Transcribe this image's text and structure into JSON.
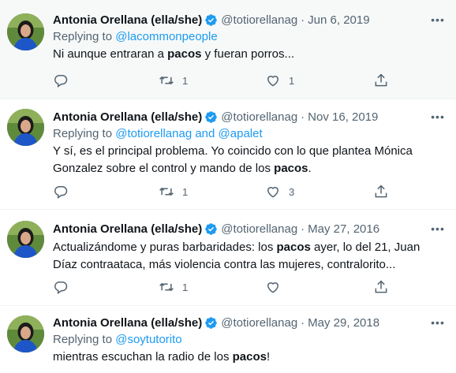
{
  "tweets": [
    {
      "name": "Antonia Orellana (ella/she)",
      "handle": "@totiorellanag",
      "date": "Jun 6, 2019",
      "replying_prefix": "Replying to",
      "replying_to": "@lacommonpeople",
      "text_parts": [
        "Ni aunque entraran a ",
        "pacos",
        " y fueran porros..."
      ],
      "retweets": "1",
      "likes": "1"
    },
    {
      "name": "Antonia Orellana (ella/she)",
      "handle": "@totiorellanag",
      "date": "Nov 16, 2019",
      "replying_prefix": "Replying to",
      "replying_to": "@totiorellanag and @apalet",
      "text_parts": [
        "Y sí, es el principal problema. Yo coincido con lo que plantea Mónica Gonzalez sobre el control y mando de los ",
        "pacos",
        "."
      ],
      "retweets": "1",
      "likes": "3"
    },
    {
      "name": "Antonia Orellana (ella/she)",
      "handle": "@totiorellanag",
      "date": "May 27, 2016",
      "text_parts": [
        "Actualizándome y puras barbaridades: los ",
        "pacos",
        " ayer, lo del 21, Juan Díaz contraataca, más violencia contra las mujeres, contralorito..."
      ],
      "retweets": "1",
      "likes": ""
    },
    {
      "name": "Antonia Orellana (ella/she)",
      "handle": "@totiorellanag",
      "date": "May 29, 2018",
      "replying_prefix": "Replying to",
      "replying_to": "@soytutorito",
      "text_parts": [
        "mientras escuchan la radio de los ",
        "pacos",
        "!"
      ]
    }
  ],
  "separator": "·",
  "icons": {
    "verified": "verified-badge-icon",
    "more": "more-icon",
    "reply": "reply-icon",
    "retweet": "retweet-icon",
    "like": "heart-icon",
    "share": "share-icon"
  },
  "colors": {
    "link": "#1d9bf0",
    "secondary_text": "#536471",
    "primary_text": "#0f1419",
    "highlight_background": "#f7f9f9"
  }
}
